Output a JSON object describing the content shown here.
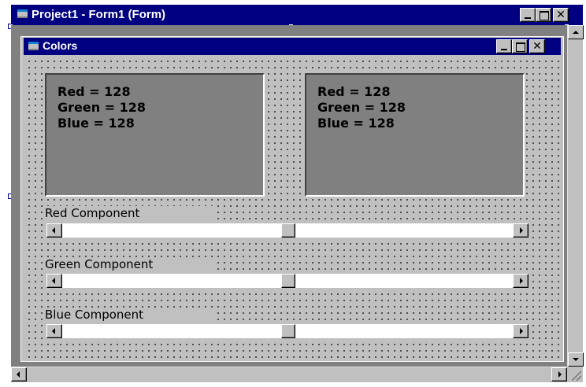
{
  "outer_window": {
    "title": "Project1 - Form1 (Form)",
    "controls": {
      "minimize": "",
      "maximize": "",
      "close": "✕"
    }
  },
  "form": {
    "title": "Colors",
    "close_glyph": "✕",
    "picture_left": {
      "red": "Red = 128",
      "green": "Green = 128",
      "blue": "Blue = 128"
    },
    "picture_right": {
      "red": "Red = 128",
      "green": "Green = 128",
      "blue": "Blue = 128"
    },
    "sliders": [
      {
        "label": "Red Component",
        "value": 128,
        "min": 0,
        "max": 255
      },
      {
        "label": "Green Component",
        "value": 128,
        "min": 0,
        "max": 255
      },
      {
        "label": "Blue Component",
        "value": 128,
        "min": 0,
        "max": 255
      }
    ]
  },
  "icons": {
    "app_icon": "form-icon",
    "minimize": "minimize-icon",
    "maximize": "maximize-icon",
    "close": "close-icon",
    "scroll_left": "arrow-left-icon",
    "scroll_right": "arrow-right-icon",
    "scroll_up": "arrow-up-icon",
    "scroll_down": "arrow-down-icon"
  },
  "colors": {
    "title_bar": "#000080",
    "window_face": "#c0c0c0",
    "picture_bg": "#808080",
    "designer_bg": "#808080"
  }
}
